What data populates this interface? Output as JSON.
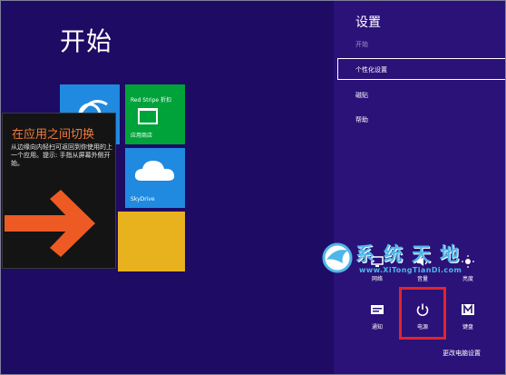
{
  "start": {
    "title": "开始",
    "tiles": {
      "store_top": "Red Stripe 折扣",
      "store_label": "应用商店",
      "skydrive_label": "SkyDrive"
    }
  },
  "switch_tip": {
    "title": "在应用之间切换",
    "body": "从边缘向内轻扫可返回到你使用的上一个应用。提示: 手指从屏幕外侧开始。"
  },
  "settings": {
    "title": "设置",
    "subtitle": "开始",
    "items": [
      "个性化设置",
      "磁贴",
      "帮助"
    ],
    "tray": {
      "network": "网络",
      "volume": "音量",
      "brightness": "亮度",
      "notifications": "通知",
      "power": "电源",
      "keyboard": "键盘"
    },
    "change_settings": "更改电脑设置"
  },
  "watermark": {
    "text": "系统天地",
    "url": "www.XiTongTianDi.com"
  },
  "colors": {
    "background": "#1e0b63",
    "charm": "#2a1279",
    "accent_highlight": "#e0252a",
    "tip_title": "#f07b3c"
  },
  "icons": [
    "ie-icon",
    "store-bag-icon",
    "cloud-icon",
    "arrow-right-icon",
    "network-icon",
    "volume-icon",
    "brightness-icon",
    "notifications-icon",
    "power-icon",
    "keyboard-icon",
    "watermark-logo-icon"
  ]
}
